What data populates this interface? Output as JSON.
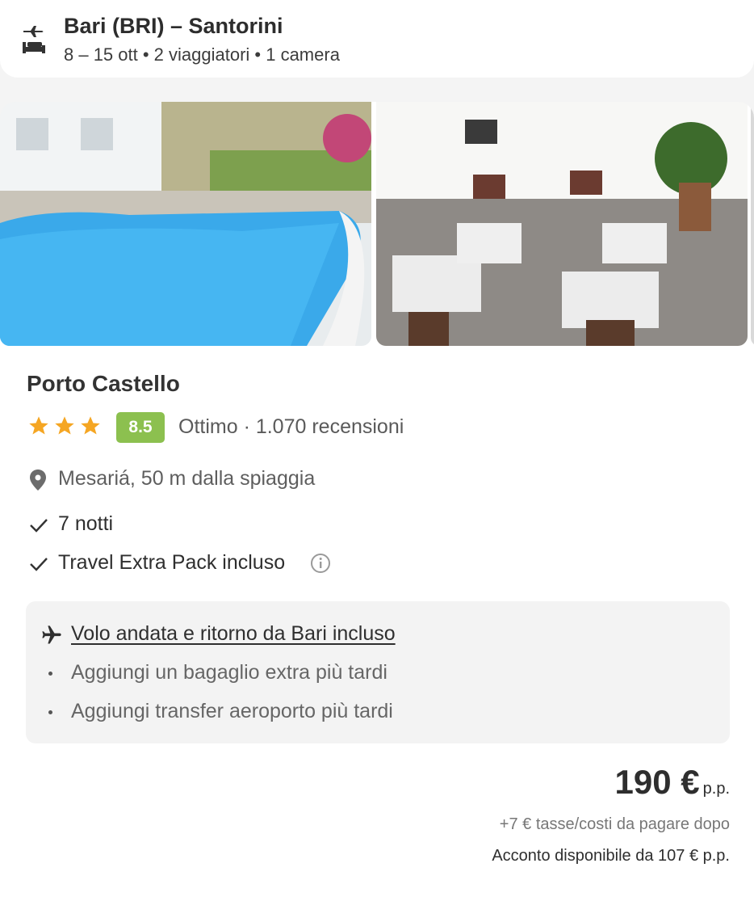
{
  "search_summary": {
    "route": "Bari (BRI) – Santorini",
    "details": "8 – 15 ott • 2 viaggiatori • 1 camera",
    "icon": "flight-hotel-icon"
  },
  "hotel": {
    "name": "Porto Castello",
    "stars": 3,
    "star_color": "#f5a623",
    "rating_score": "8.5",
    "rating_color": "#8cc04f",
    "rating_text": "Ottimo · 1.070 recensioni",
    "location": "Mesariá, 50 m dalla spiaggia",
    "photos": [
      "pool-photo",
      "dining-room-photo"
    ]
  },
  "features": [
    {
      "label": "7 notti",
      "icon": "check-icon"
    },
    {
      "label": "Travel Extra Pack incluso",
      "icon": "check-icon"
    }
  ],
  "flight": {
    "title": "Volo andata e ritorno da Bari incluso",
    "items": [
      "Aggiungi un bagaglio extra più tardi",
      "Aggiungi transfer aeroporto più tardi"
    ]
  },
  "price": {
    "amount": "190 €",
    "unit": "p.p.",
    "fees": "+7 € tasse/costi da pagare dopo",
    "deposit": "Acconto disponibile da 107 € p.p."
  }
}
